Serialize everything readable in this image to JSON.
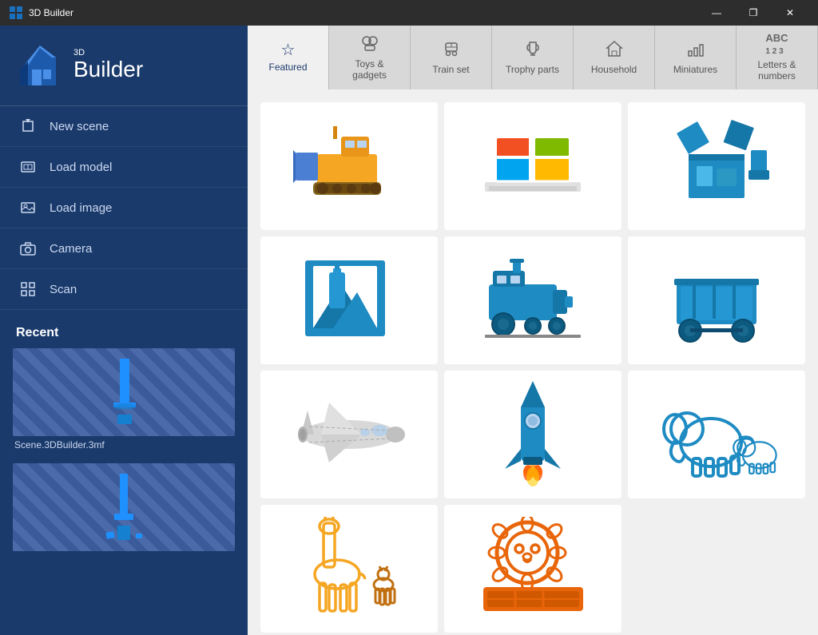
{
  "titleBar": {
    "title": "3D Builder",
    "controls": {
      "minimize": "—",
      "maximize": "❐",
      "close": "✕"
    }
  },
  "sidebar": {
    "logoSmall": "3D",
    "logoBig": "Builder",
    "menuItems": [
      {
        "id": "new-scene",
        "label": "New scene",
        "icon": "✦"
      },
      {
        "id": "load-model",
        "label": "Load model",
        "icon": "⬜"
      },
      {
        "id": "load-image",
        "label": "Load image",
        "icon": "⬡"
      },
      {
        "id": "camera",
        "label": "Camera",
        "icon": "⊙"
      },
      {
        "id": "scan",
        "label": "Scan",
        "icon": "▣"
      }
    ],
    "recentLabel": "Recent",
    "recentItems": [
      {
        "id": "recent-1",
        "label": "Scene.3DBuilder.3mf"
      },
      {
        "id": "recent-2",
        "label": ""
      },
      {
        "id": "recent-3",
        "label": ""
      }
    ]
  },
  "tabs": [
    {
      "id": "featured",
      "label": "Featured",
      "icon": "☆",
      "active": true
    },
    {
      "id": "toys",
      "label": "Toys &\ngadgets",
      "icon": "👤"
    },
    {
      "id": "trainset",
      "label": "Train set",
      "icon": "🎫"
    },
    {
      "id": "trophy",
      "label": "Trophy parts",
      "icon": "🏆"
    },
    {
      "id": "household",
      "label": "Household",
      "icon": "🏠"
    },
    {
      "id": "miniatures",
      "label": "Miniatures",
      "icon": "📊"
    },
    {
      "id": "letters",
      "label": "Letters &\nnumbers",
      "icon": "ABC"
    }
  ],
  "grid": {
    "items": [
      {
        "id": "bulldozer",
        "color": "#f5a623",
        "shape": "bulldozer"
      },
      {
        "id": "windows-logo",
        "color": "multicolor",
        "shape": "windows"
      },
      {
        "id": "box-parts",
        "color": "#1e8bc3",
        "shape": "box-parts"
      },
      {
        "id": "frame-bottle",
        "color": "#1e8bc3",
        "shape": "frame-bottle"
      },
      {
        "id": "train",
        "color": "#1e8bc3",
        "shape": "train"
      },
      {
        "id": "cart",
        "color": "#1e8bc3",
        "shape": "cart"
      },
      {
        "id": "shuttle",
        "color": "#d0d0d0",
        "shape": "shuttle"
      },
      {
        "id": "rocket",
        "color": "#1e8bc3",
        "shape": "rocket"
      },
      {
        "id": "elephant",
        "color": "#1e8bc3",
        "shape": "elephant"
      },
      {
        "id": "giraffe",
        "color": "#f5a623",
        "shape": "giraffe"
      },
      {
        "id": "lion",
        "color": "#e8650a",
        "shape": "lion"
      }
    ]
  }
}
